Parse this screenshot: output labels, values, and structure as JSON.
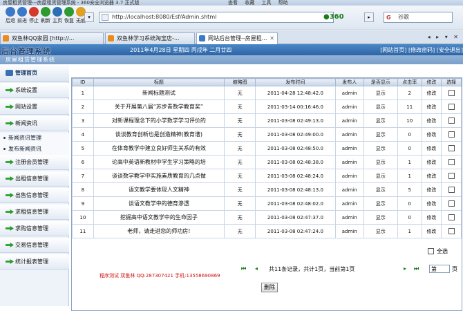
{
  "browser": {
    "title_text": "房屋租赁管理---房屋租赁管理系统 - 360安全浏览器 3.7 正式版",
    "menu_text": "查看 收藏 工具 帮助",
    "toolbar": [
      {
        "icon": "back-arrow-icon",
        "label": "后退",
        "color": "#3a78c9"
      },
      {
        "icon": "forward-arrow-icon",
        "label": "前进",
        "color": "#3a78c9"
      },
      {
        "icon": "stop-icon",
        "label": "停止",
        "color": "#d33a2c"
      },
      {
        "icon": "refresh-icon",
        "label": "刷新",
        "color": "#2f9a2f"
      },
      {
        "icon": "home-icon",
        "label": "主页",
        "color": "#2a6fb5"
      },
      {
        "icon": "restore-icon",
        "label": "恢复",
        "color": "#2f9a2f"
      },
      {
        "icon": "traceless-icon",
        "label": "无痕",
        "color": "#e0a020"
      }
    ],
    "address": "http://localhost:8080/Esf/Admin.shtml",
    "brand_360": "●360",
    "search_placeholder": "谷歌",
    "search_logo": "G",
    "tabs": [
      {
        "label": "双鱼林QQ家园 [http://...",
        "active": false
      },
      {
        "label": "双鱼林学习系统淘宝店-...",
        "active": false
      },
      {
        "label": "网站后台管理--房屋租...",
        "active": true
      }
    ],
    "tab_controls": "◂ ▸ ▾ ✕"
  },
  "app": {
    "logo": "后台管理系统",
    "date_line": "2011年4月28日 星期四 丙戌年 二月廿四",
    "top_links": "[网站首页] [修改密码] [安全退出]",
    "subtitle": "房屋租赁管理系统",
    "colors": {
      "header": "#2d64a6",
      "credit": "#d01010",
      "accent": "#2a9b2a"
    }
  },
  "sidebar": {
    "head": "管理首页",
    "items": [
      {
        "label": "系统设置",
        "type": "item"
      },
      {
        "label": "网站设置",
        "type": "item"
      },
      {
        "label": "新闻资讯",
        "type": "item"
      },
      {
        "label": "新闻资讯管理",
        "type": "sub"
      },
      {
        "label": "发布新闻资讯",
        "type": "sub"
      },
      {
        "label": "注册会员管理",
        "type": "item"
      },
      {
        "label": "出租信息管理",
        "type": "item"
      },
      {
        "label": "出售信息管理",
        "type": "item"
      },
      {
        "label": "求租信息管理",
        "type": "item"
      },
      {
        "label": "求购信息管理",
        "type": "item"
      },
      {
        "label": "交易信息管理",
        "type": "item"
      },
      {
        "label": "统计报表管理",
        "type": "item"
      }
    ]
  },
  "table": {
    "headers": [
      "ID",
      "标题",
      "缩略图",
      "发布时间",
      "发布人",
      "是否显示",
      "点击率",
      "修改",
      "选择"
    ],
    "rows": [
      [
        "1",
        "新闻标题测试",
        "无",
        "2011-04-28 12:48:42.0",
        "admin",
        "显示",
        "2",
        "修改"
      ],
      [
        "2",
        "关于开展第八届“苏步青数学教育奖”",
        "无",
        "2011-03-14 00:16:46.0",
        "admin",
        "显示",
        "11",
        "修改"
      ],
      [
        "3",
        "对新课程理念下的小学数学学习评价的",
        "无",
        "2011-03-08 02:49:13.0",
        "admin",
        "显示",
        "10",
        "修改"
      ],
      [
        "4",
        "谈谈教育创新也是创造精神(教育谱)",
        "无",
        "2011-03-08 02:49:00.0",
        "admin",
        "显示",
        "0",
        "修改"
      ],
      [
        "5",
        "在体育教学中建立良好师生关系的有效",
        "无",
        "2011-03-08 02:48:50.0",
        "admin",
        "显示",
        "0",
        "修改"
      ],
      [
        "6",
        "论高中英语新教材中学生学习策略的培",
        "无",
        "2011-03-08 02:48:38.0",
        "admin",
        "显示",
        "1",
        "修改"
      ],
      [
        "7",
        "谈谈数学教学中实施素质教育的几点做",
        "无",
        "2011-03-08 02:48:24.0",
        "admin",
        "显示",
        "1",
        "修改"
      ],
      [
        "8",
        "语文教学要体现人文精神",
        "无",
        "2011-03-08 02:48:13.0",
        "admin",
        "显示",
        "5",
        "修改"
      ],
      [
        "9",
        "谈语文教学中的德育渗透",
        "无",
        "2011-03-08 02:48:02.0",
        "admin",
        "显示",
        "0",
        "修改"
      ],
      [
        "10",
        "挖掘高中语文教学中的生命因子",
        "无",
        "2011-03-08 02:47:37.0",
        "admin",
        "显示",
        "0",
        "修改"
      ],
      [
        "11",
        "老师，请走进您的师功房!",
        "无",
        "2011-03-08 02:47:24.0",
        "admin",
        "显示",
        "1",
        "修改"
      ]
    ],
    "select_all": "全选"
  },
  "footer": {
    "credit": "程序测试 双鱼林 QQ:287307421 手机:13558690869",
    "pager_text": "共11条记录，共计1页，当前第1页",
    "page_input": "第",
    "page_unit": "页",
    "delete_button": "删除"
  }
}
